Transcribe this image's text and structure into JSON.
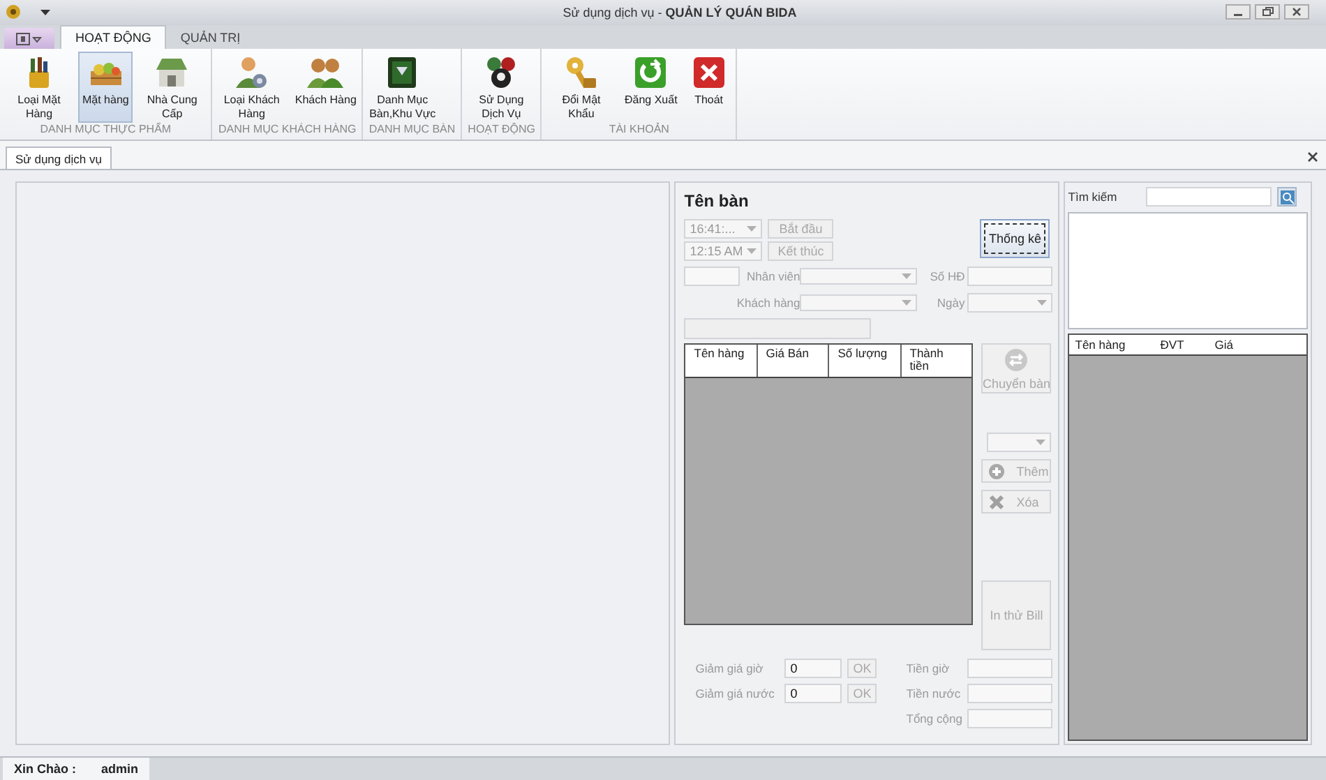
{
  "window": {
    "title": "Sử dụng dịch vụ - **QUẢN LÝ QUÁN BIDA**"
  },
  "ribbon_tabs": [
    {
      "label": "HOẠT ĐỘNG",
      "selected": true
    },
    {
      "label": "QUẢN TRỊ",
      "selected": false
    }
  ],
  "ribbon_groups": [
    {
      "label": "DANH MỤC THỰC PHẨM",
      "buttons": [
        {
          "label": "Loại Mặt Hàng",
          "kind": "basket",
          "selected": false
        },
        {
          "label": "Mặt hàng",
          "kind": "crate",
          "selected": true
        },
        {
          "label": "Nhà Cung Cấp",
          "kind": "store",
          "selected": false
        }
      ]
    },
    {
      "label": "DANH MỤC KHÁCH HÀNG",
      "buttons": [
        {
          "label": "Loại Khách Hàng",
          "kind": "usergear",
          "selected": false
        },
        {
          "label": "Khách Hàng",
          "kind": "users",
          "selected": false
        }
      ]
    },
    {
      "label": "DANH MỤC BÀN",
      "buttons": [
        {
          "label": "Danh Mục Bàn,Khu Vực",
          "kind": "board",
          "selected": false
        }
      ]
    },
    {
      "label": "HOẠT ĐỘNG",
      "buttons": [
        {
          "label": "Sử Dụng Dịch Vụ",
          "kind": "balls",
          "selected": false
        }
      ]
    },
    {
      "label": "TÀI KHOẢN",
      "buttons": [
        {
          "label": "Đổi Mật Khẩu",
          "kind": "key",
          "selected": false
        },
        {
          "label": "Đăng Xuất",
          "kind": "logout",
          "selected": false
        },
        {
          "label": "Thoát",
          "kind": "exit",
          "selected": false
        }
      ]
    }
  ],
  "document_tab": {
    "label": "Sử dụng dịch vụ",
    "selected": true
  },
  "service": {
    "title": "Tên bàn",
    "start_time": {
      "value": "16:41:...",
      "button": "Bắt đầu",
      "disabled": true
    },
    "end_time": {
      "value": "12:15 AM",
      "button": "Kết thúc",
      "disabled": true
    },
    "stats_button": {
      "label": "Thống kê",
      "disabled": false
    },
    "staff_label": "Nhân viên",
    "invoice_label": "Số HĐ",
    "customer_label": "Khách hàng",
    "date_label": "Ngày",
    "bill_columns": [
      "Tên hàng",
      "Giá Bán",
      "Số lượng",
      "Thành tiền"
    ],
    "side_buttons": [
      {
        "kind": "move",
        "label": "Chuyển bàn",
        "disabled": true
      },
      {
        "kind": "select"
      },
      {
        "kind": "add",
        "label": "Thêm",
        "disabled": true
      },
      {
        "kind": "delete",
        "label": "Xóa",
        "disabled": true
      },
      {
        "kind": "print",
        "label": "In thử Bill",
        "disabled": true
      }
    ],
    "discounts": [
      {
        "label": "Giảm giá giờ",
        "value": "0",
        "button": "OK",
        "disabled": true
      },
      {
        "label": "Giảm giá nước",
        "value": "0",
        "button": "OK",
        "disabled": true
      }
    ],
    "totals": [
      "Tiền giờ",
      "Tiền nước",
      "Tổng cộng"
    ]
  },
  "products": {
    "search_label": "Tìm kiếm",
    "columns": [
      "Tên hàng",
      "ĐVT",
      "Giá"
    ]
  },
  "status_bar": {
    "greeting": "Xin Chào :",
    "user": "admin"
  }
}
